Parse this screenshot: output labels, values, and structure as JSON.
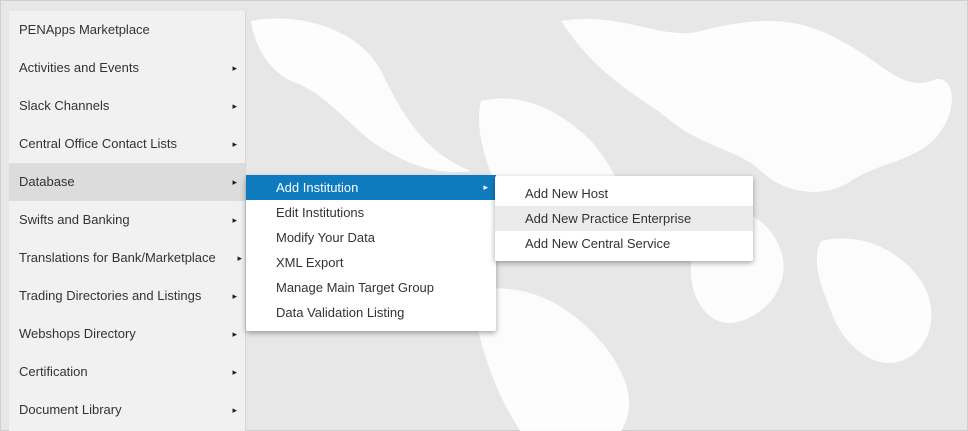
{
  "main_menu": {
    "items": [
      {
        "label": "PENApps Marketplace",
        "arrow": ""
      },
      {
        "label": "Activities and Events",
        "arrow": "▸"
      },
      {
        "label": "Slack Channels",
        "arrow": "▸"
      },
      {
        "label": "Central Office Contact Lists",
        "arrow": "▸"
      },
      {
        "label": "Database",
        "arrow": "▸"
      },
      {
        "label": "Swifts and Banking",
        "arrow": "▸"
      },
      {
        "label": "Translations for Bank/Marketplace",
        "arrow": "▸"
      },
      {
        "label": "Trading Directories and Listings",
        "arrow": "▸"
      },
      {
        "label": "Webshops Directory",
        "arrow": "▸"
      },
      {
        "label": "Certification",
        "arrow": "▸"
      },
      {
        "label": "Document Library",
        "arrow": "▸"
      }
    ]
  },
  "database_submenu": {
    "items": [
      {
        "label": "Add Institution",
        "arrow": "▸"
      },
      {
        "label": "Edit Institutions"
      },
      {
        "label": "Modify Your Data"
      },
      {
        "label": "XML Export"
      },
      {
        "label": "Manage Main Target Group"
      },
      {
        "label": "Data Validation Listing"
      }
    ]
  },
  "add_institution_submenu": {
    "items": [
      {
        "label": "Add New Host"
      },
      {
        "label": "Add New Practice Enterprise"
      },
      {
        "label": "Add New Central Service"
      }
    ]
  },
  "colors": {
    "highlight": "#0e7bbf",
    "menu_bg": "#f1f1f1",
    "active_item": "#dcdcdc"
  }
}
